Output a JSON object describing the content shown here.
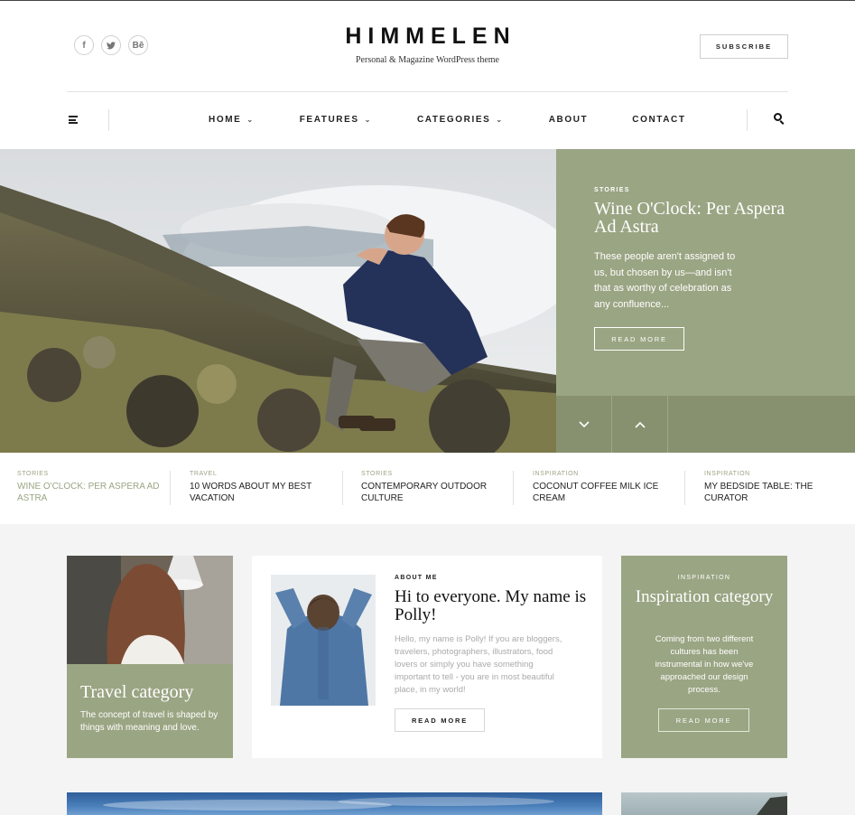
{
  "header": {
    "brand": "HIMMELEN",
    "tagline": "Personal & Magazine WordPress theme",
    "subscribe": "SUBSCRIBE",
    "social": [
      {
        "icon": "facebook-icon",
        "glyph": "f"
      },
      {
        "icon": "twitter-icon",
        "glyph": "t"
      },
      {
        "icon": "behance-icon",
        "glyph": "Bē"
      }
    ]
  },
  "nav": {
    "items": [
      {
        "label": "HOME",
        "has_dropdown": true
      },
      {
        "label": "FEATURES",
        "has_dropdown": true
      },
      {
        "label": "CATEGORIES",
        "has_dropdown": true
      },
      {
        "label": "ABOUT",
        "has_dropdown": false
      },
      {
        "label": "CONTACT",
        "has_dropdown": false
      }
    ],
    "menu_icon": "hamburger-icon",
    "search_icon": "search-icon"
  },
  "hero": {
    "category": "STORIES",
    "title": "Wine O'Clock: Per Aspera Ad Astra",
    "excerpt": "These people aren't assigned to us, but chosen by us—and isn't that as worthy of celebration as any confluence...",
    "button": "READ MORE",
    "arrows": [
      "chevron-down-icon",
      "chevron-up-icon"
    ]
  },
  "strip": [
    {
      "category": "STORIES",
      "title": "WINE O'CLOCK: PER ASPERA AD ASTRA",
      "active": true
    },
    {
      "category": "TRAVEL",
      "title": "10 WORDS ABOUT MY BEST VACATION",
      "active": false
    },
    {
      "category": "STORIES",
      "title": "CONTEMPORARY OUTDOOR CULTURE",
      "active": false
    },
    {
      "category": "INSPIRATION",
      "title": "COCONUT COFFEE MILK ICE CREAM",
      "active": false
    },
    {
      "category": "INSPIRATION",
      "title": "MY BEDSIDE TABLE: THE CURATOR",
      "active": false
    }
  ],
  "cards": {
    "travel": {
      "title": "Travel category",
      "desc": "The concept of travel is shaped by things with meaning and love."
    },
    "about": {
      "label": "ABOUT ME",
      "headline": "Hi to everyone. My name is Polly!",
      "body": "Hello, my name is Polly! If you are bloggers, travelers, photographers, illustrators, food lovers or simply you have something important to tell - you are in most beautiful place, in my world!",
      "button": "READ MORE"
    },
    "inspiration": {
      "label": "INSPIRATION",
      "title": "Inspiration category",
      "desc": "Coming from two different cultures has been instrumental in how we've approached our design process.",
      "button": "READ MORE"
    }
  },
  "colors": {
    "accent": "#9aa583",
    "accent_dark": "#87916f",
    "text": "#222222",
    "muted": "#aaaaaa"
  }
}
